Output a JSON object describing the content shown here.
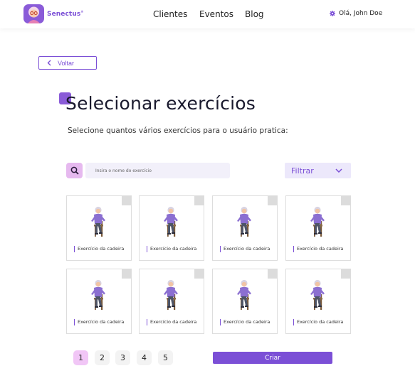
{
  "header": {
    "brand": "Senectus",
    "brand_mark": "®",
    "nav": [
      {
        "label": "Clientes"
      },
      {
        "label": "Eventos"
      },
      {
        "label": "Blog"
      }
    ],
    "user_greeting": "Olá, John Doe",
    "user_icon": "gear-icon"
  },
  "back": {
    "label": "Voltar",
    "icon": "chevron-left-icon"
  },
  "page": {
    "title": "Selecionar exercícios",
    "subtitle": "Selecione quantos vários exercícios para o usuário pratica:"
  },
  "search": {
    "placeholder": "Insira o nome do exercício",
    "value": "",
    "icon": "search-icon"
  },
  "filter": {
    "label": "Filtrar",
    "icon": "chevron-down-icon"
  },
  "exercises": [
    {
      "label": "Exercício da cadeira",
      "checked": false
    },
    {
      "label": "Exercício da cadeira",
      "checked": false
    },
    {
      "label": "Exercício da cadeira",
      "checked": false
    },
    {
      "label": "Exercício da cadeira",
      "checked": false
    },
    {
      "label": "Exercício da cadeira",
      "checked": false
    },
    {
      "label": "Exercício da cadeira",
      "checked": false
    },
    {
      "label": "Exercício da cadeira",
      "checked": false
    },
    {
      "label": "Exercício da cadeira",
      "checked": false
    }
  ],
  "pagination": {
    "pages": [
      "1",
      "2",
      "3",
      "4",
      "5"
    ],
    "current": "1"
  },
  "actions": {
    "create_label": "Criar"
  },
  "colors": {
    "accent": "#7b4fd6",
    "accent_soft": "#ece8fb",
    "pink_soft": "#f1c6f6",
    "checkbox": "#dcdcdc"
  }
}
